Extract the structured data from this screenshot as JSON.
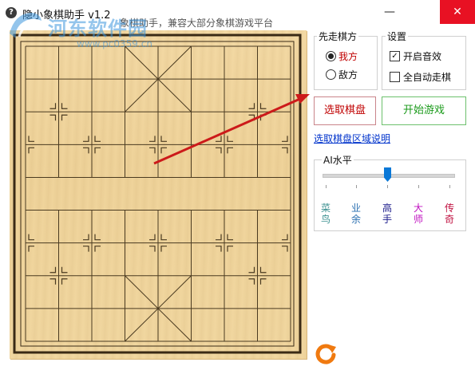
{
  "window": {
    "title": "隐小象棋助手 v1.2",
    "subtitle": "象棋助手，兼容大部分象棋游戏平台",
    "minimize_glyph": "—",
    "close_glyph": "✕"
  },
  "watermark": {
    "text": "河东软件园",
    "url": "www.pc0359.cn"
  },
  "side_group": {
    "title": "先走棋方",
    "options": [
      {
        "label": "我方",
        "selected": true,
        "color": "#c00000"
      },
      {
        "label": "敌方",
        "selected": false,
        "color": "#111111"
      }
    ]
  },
  "settings_group": {
    "title": "设置",
    "options": [
      {
        "label": "开启音效",
        "checked": true
      },
      {
        "label": "全自动走棋",
        "checked": false
      }
    ]
  },
  "buttons": {
    "select_board": "选取棋盘",
    "start_game": "开始游戏"
  },
  "help_link": "选取棋盘区域说明",
  "ai_group": {
    "title": "AI水平",
    "levels": [
      {
        "label": "菜鸟",
        "color": "#3a8f8f"
      },
      {
        "label": "业余",
        "color": "#2a6fb0"
      },
      {
        "label": "高手",
        "color": "#1a1a8a"
      },
      {
        "label": "大师",
        "color": "#c010c0"
      },
      {
        "label": "传奇",
        "color": "#c01040"
      }
    ],
    "selected_index": 2
  },
  "colors": {
    "board_line": "#4a3a20",
    "arrow": "#cc1a1a",
    "refresh_orange": "#f07a10"
  }
}
